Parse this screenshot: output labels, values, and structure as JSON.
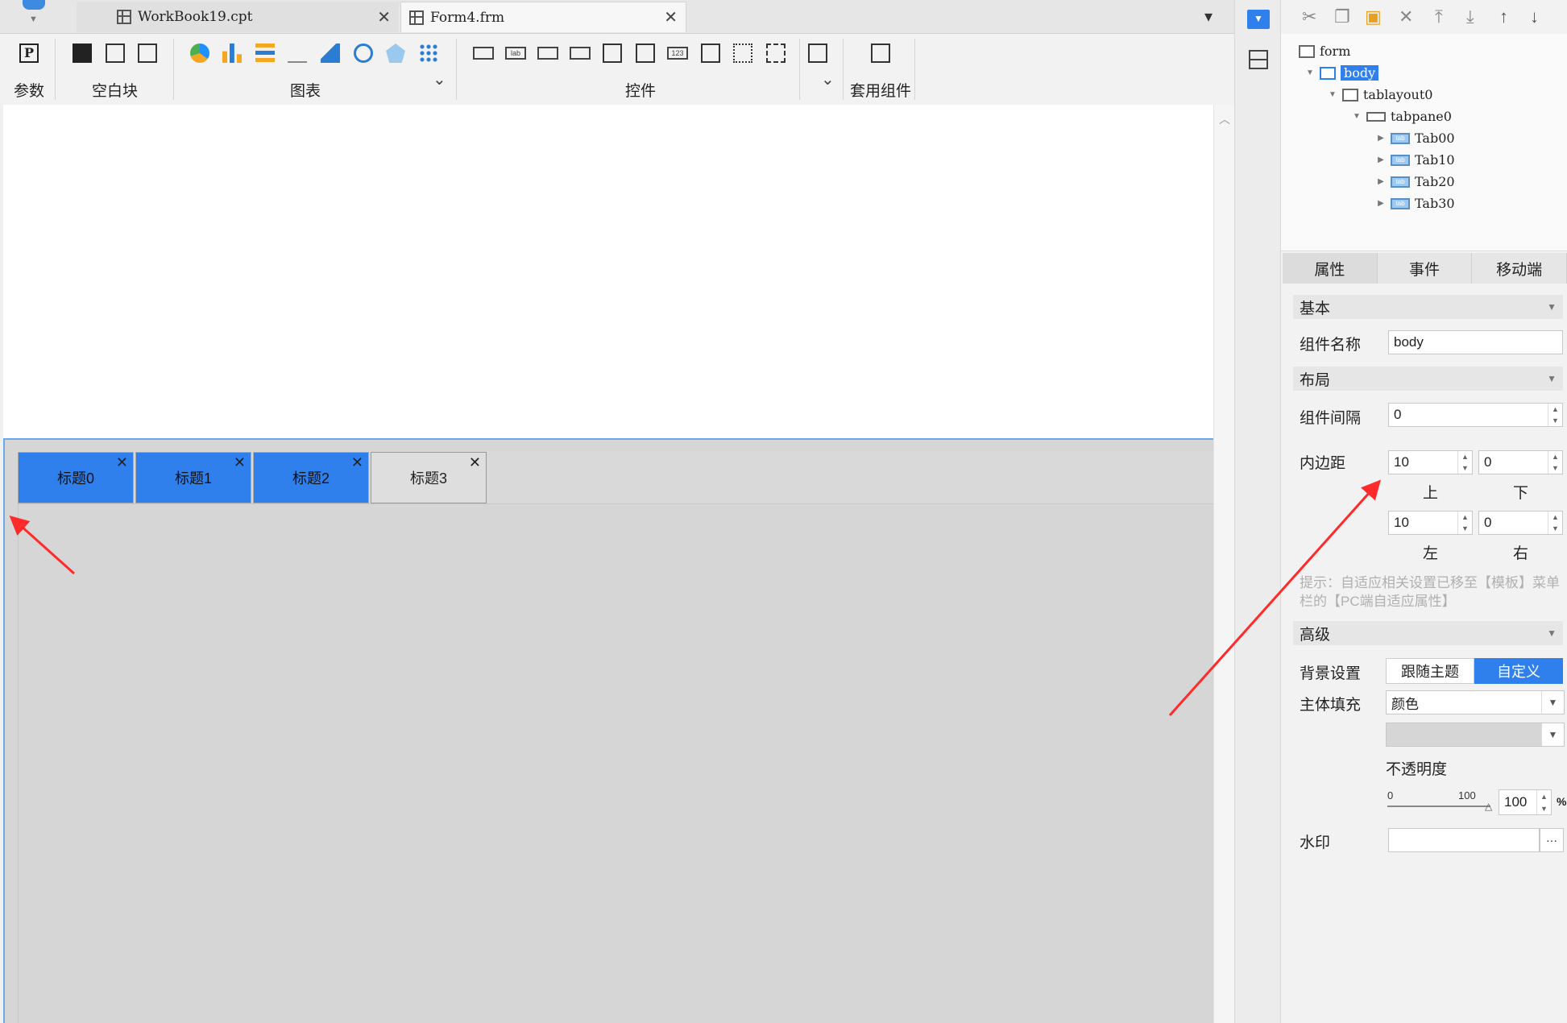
{
  "tabs": {
    "workbook": "WorkBook19.cpt",
    "form": "Form4.frm"
  },
  "ribbon": {
    "param_label": "参数",
    "blank_label": "空白块",
    "chart_label": "图表",
    "control_label": "控件",
    "widget_label": "套用组件",
    "p_glyph": "P",
    "lab_glyph": "lab",
    "num_glyph": "123"
  },
  "canvas": {
    "tab_titles": [
      "标题0",
      "标题1",
      "标题2",
      "标题3"
    ],
    "active_tabs": 3
  },
  "tree": {
    "form": "form",
    "body": "body",
    "tablayout": "tablayout0",
    "tabpane": "tabpane0",
    "tabs": [
      "Tab00",
      "Tab10",
      "Tab20",
      "Tab30"
    ],
    "tab_glyph": "tab"
  },
  "props": {
    "tabs": [
      "属性",
      "事件",
      "移动端"
    ],
    "basic": "基本",
    "name_label": "组件名称",
    "name_value": "body",
    "layout": "布局",
    "gap_label": "组件间隔",
    "gap_value": "0",
    "padding_label": "内边距",
    "pad_top": "10",
    "pad_bottom": "0",
    "pad_left": "10",
    "pad_right": "0",
    "top_label": "上",
    "bottom_label": "下",
    "left_label": "左",
    "right_label": "右",
    "hint": "提示：自适应相关设置已移至【模板】菜单栏的【PC端自适应属性】",
    "advanced": "高级",
    "bg_label": "背景设置",
    "bg_follow": "跟随主题",
    "bg_custom": "自定义",
    "fill_label": "主体填充",
    "fill_value": "颜色",
    "opacity_label": "不透明度",
    "slider_min": "0",
    "slider_max": "100",
    "opacity_value": "100",
    "percent": "%",
    "watermark_label": "水印",
    "watermark_btn": "···"
  },
  "colors": {
    "accent": "#2f80ed",
    "annotation_arrow": "#ff2a2a"
  }
}
